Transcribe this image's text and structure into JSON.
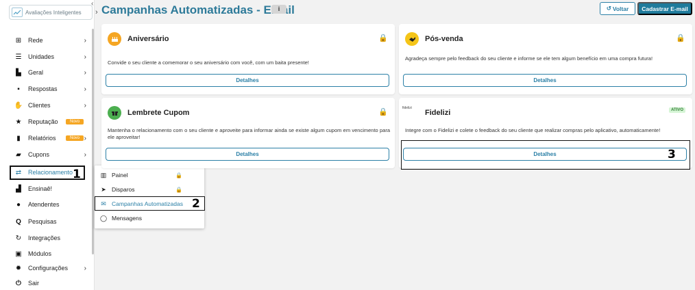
{
  "sidebar": {
    "logo_text": "Avaliações Inteligentes",
    "items": [
      {
        "label": "Rede",
        "icon": "network-icon",
        "has_chevron": true
      },
      {
        "label": "Unidades",
        "icon": "units-icon",
        "has_chevron": true
      },
      {
        "label": "Geral",
        "icon": "chart-area-icon",
        "has_chevron": true
      },
      {
        "label": "Respostas",
        "icon": "comment-icon",
        "has_chevron": true
      },
      {
        "label": "Clientes",
        "icon": "handshake-icon",
        "has_chevron": true
      },
      {
        "label": "Reputação",
        "icon": "star-icon",
        "has_chevron": false,
        "badge": "Novo"
      },
      {
        "label": "Relatórios",
        "icon": "report-icon",
        "has_chevron": true,
        "badge": "Novo"
      },
      {
        "label": "Cupons",
        "icon": "coupon-icon",
        "has_chevron": true
      },
      {
        "label": "Relacionamento",
        "icon": "relationship-icon",
        "has_chevron": false,
        "active": true
      },
      {
        "label": "Ensinaê!",
        "icon": "teacher-icon",
        "has_chevron": false
      },
      {
        "label": "Atendentes",
        "icon": "users-icon",
        "has_chevron": false
      },
      {
        "label": "Pesquisas",
        "icon": "search-icon",
        "has_chevron": false
      },
      {
        "label": "Integrações",
        "icon": "sync-icon",
        "has_chevron": false
      },
      {
        "label": "Módulos",
        "icon": "modules-icon",
        "has_chevron": false
      },
      {
        "label": "Configurações",
        "icon": "gear-icon",
        "has_chevron": true
      },
      {
        "label": "Sair",
        "icon": "power-icon",
        "has_chevron": false
      }
    ]
  },
  "submenu": {
    "items": [
      {
        "label": "Painel",
        "icon": "bar-chart-icon",
        "locked": true
      },
      {
        "label": "Disparos",
        "icon": "send-icon",
        "locked": true
      },
      {
        "label": "Campanhas Automatizadas",
        "icon": "envelope-icon",
        "locked": false,
        "active": true
      },
      {
        "label": "Mensagens",
        "icon": "whatsapp-icon",
        "locked": false
      }
    ]
  },
  "header": {
    "title": "Campanhas Automatizadas - Email",
    "info_label": "i",
    "voltar_label": "Voltar",
    "cadastrar_label": "Cadastrar E-mail"
  },
  "cards": [
    {
      "title": "Aniversário",
      "icon": "cake-icon",
      "icon_bg": "#f5a623",
      "description": "Convide o seu cliente a comemorar o seu aniversário com você, com um baita presente!",
      "button": "Detalhes",
      "locked": true
    },
    {
      "title": "Pós-venda",
      "icon": "handshake-icon",
      "icon_bg": "#f5c518",
      "description": "Agradeça sempre pelo feedback do seu cliente e informe se ele tem algum benefício em uma compra futura!",
      "button": "Detalhes",
      "locked": true
    },
    {
      "title": "Lembrete Cupom",
      "icon": "gift-icon",
      "icon_bg": "#4caf50",
      "description": "Mantenha o relacionamento com o seu cliente e aproveite para informar ainda se existe algum cupom em vencimento para ele aproveitar!",
      "button": "Detalhes",
      "locked": true
    },
    {
      "title": "Fidelizi",
      "brand": "fidelizi",
      "description": "Integre com o Fidelizi e colete o feedback do seu cliente que realizar compras pelo aplicativo, automaticamente!",
      "button": "Detalhes",
      "status": "ATIVO"
    }
  ],
  "annotations": {
    "step1": "1",
    "step2": "2",
    "step3": "3"
  },
  "colors": {
    "accent": "#2a7fa6",
    "primary_button": "#1f7b9c",
    "lock": "#f0a020",
    "badge_new": "#f5a623"
  }
}
